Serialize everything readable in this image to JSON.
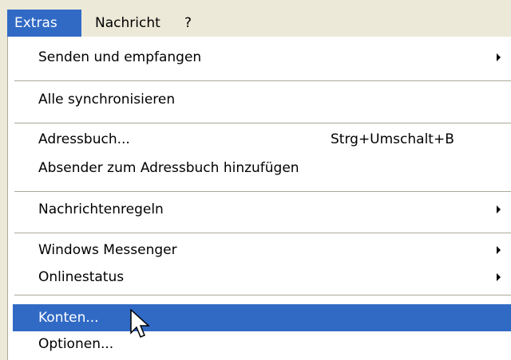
{
  "menubar": {
    "items": [
      {
        "label": "Extras",
        "active": true
      },
      {
        "label": "Nachricht",
        "active": false
      },
      {
        "label": "?",
        "active": false
      }
    ]
  },
  "dropdown": {
    "groups": [
      [
        {
          "label": "Senden und empfangen",
          "submenu": true
        }
      ],
      [
        {
          "label": "Alle synchronisieren"
        }
      ],
      [
        {
          "label": "Adressbuch...",
          "shortcut": "Strg+Umschalt+B"
        },
        {
          "label": "Absender zum Adressbuch hinzufügen"
        }
      ],
      [
        {
          "label": "Nachrichtenregeln",
          "submenu": true
        }
      ],
      [
        {
          "label": "Windows Messenger",
          "submenu": true
        },
        {
          "label": "Onlinestatus",
          "submenu": true
        }
      ],
      [
        {
          "label": "Konten...",
          "highlighted": true
        },
        {
          "label": "Optionen..."
        }
      ]
    ]
  },
  "colors": {
    "highlight": "#316ac5",
    "menubar_bg": "#ece9d8",
    "menu_bg": "#ffffff",
    "separator": "#aca899"
  },
  "icons": {
    "submenu_indicator": "submenu-arrow-icon",
    "mouse_pointer": "mouse-cursor-icon"
  }
}
